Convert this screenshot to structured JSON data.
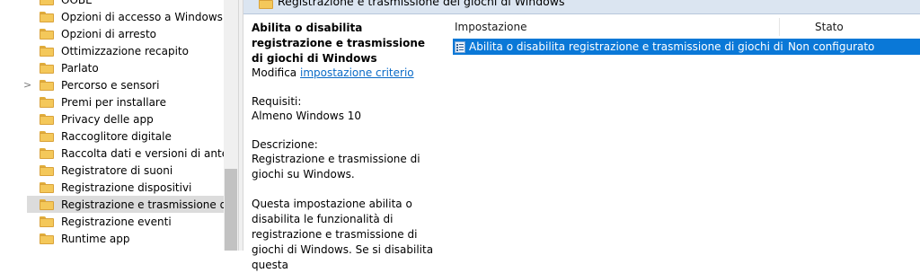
{
  "tree": {
    "items": [
      {
        "label": "OOBE",
        "expandable": false
      },
      {
        "label": "Opzioni di accesso a Windows",
        "expandable": false
      },
      {
        "label": "Opzioni di arresto",
        "expandable": false
      },
      {
        "label": "Ottimizzazione recapito",
        "expandable": false
      },
      {
        "label": "Parlato",
        "expandable": false
      },
      {
        "label": "Percorso e sensori",
        "expandable": true
      },
      {
        "label": "Premi per installare",
        "expandable": false
      },
      {
        "label": "Privacy delle app",
        "expandable": false
      },
      {
        "label": "Raccoglitore digitale",
        "expandable": false
      },
      {
        "label": "Raccolta dati e versioni di antepr",
        "expandable": false
      },
      {
        "label": "Registratore di suoni",
        "expandable": false
      },
      {
        "label": "Registrazione dispositivi",
        "expandable": false
      },
      {
        "label": "Registrazione e trasmissione dei",
        "expandable": false,
        "selected": true
      },
      {
        "label": "Registrazione eventi",
        "expandable": false
      },
      {
        "label": "Runtime app",
        "expandable": false
      }
    ],
    "expander_glyph": ">"
  },
  "header": {
    "title": "Registrazione e trasmissione dei giochi di Windows"
  },
  "description": {
    "title": "Abilita o disabilita registrazione e trasmissione di giochi di Windows",
    "edit_prefix": "Modifica",
    "edit_link": "impostazione criterio",
    "requirements_label": "Requisiti:",
    "requirements_value": "Almeno Windows 10",
    "description_label": "Descrizione:",
    "description_text": "Registrazione e trasmissione di giochi su Windows.",
    "policy_text": "Questa impostazione abilita o disabilita le funzionalità di registrazione e trasmissione di giochi di Windows. Se si disabilita questa"
  },
  "list": {
    "columns": {
      "setting": "Impostazione",
      "state": "Stato"
    },
    "rows": [
      {
        "setting": "Abilita o disabilita registrazione e trasmissione di giochi di Wi...",
        "state": "Non configurato",
        "selected": true
      }
    ]
  },
  "colors": {
    "selection": "#0a78d7",
    "header_band": "#dbe5f1",
    "link": "#0b6bc7",
    "folder": "#f4c85a"
  }
}
